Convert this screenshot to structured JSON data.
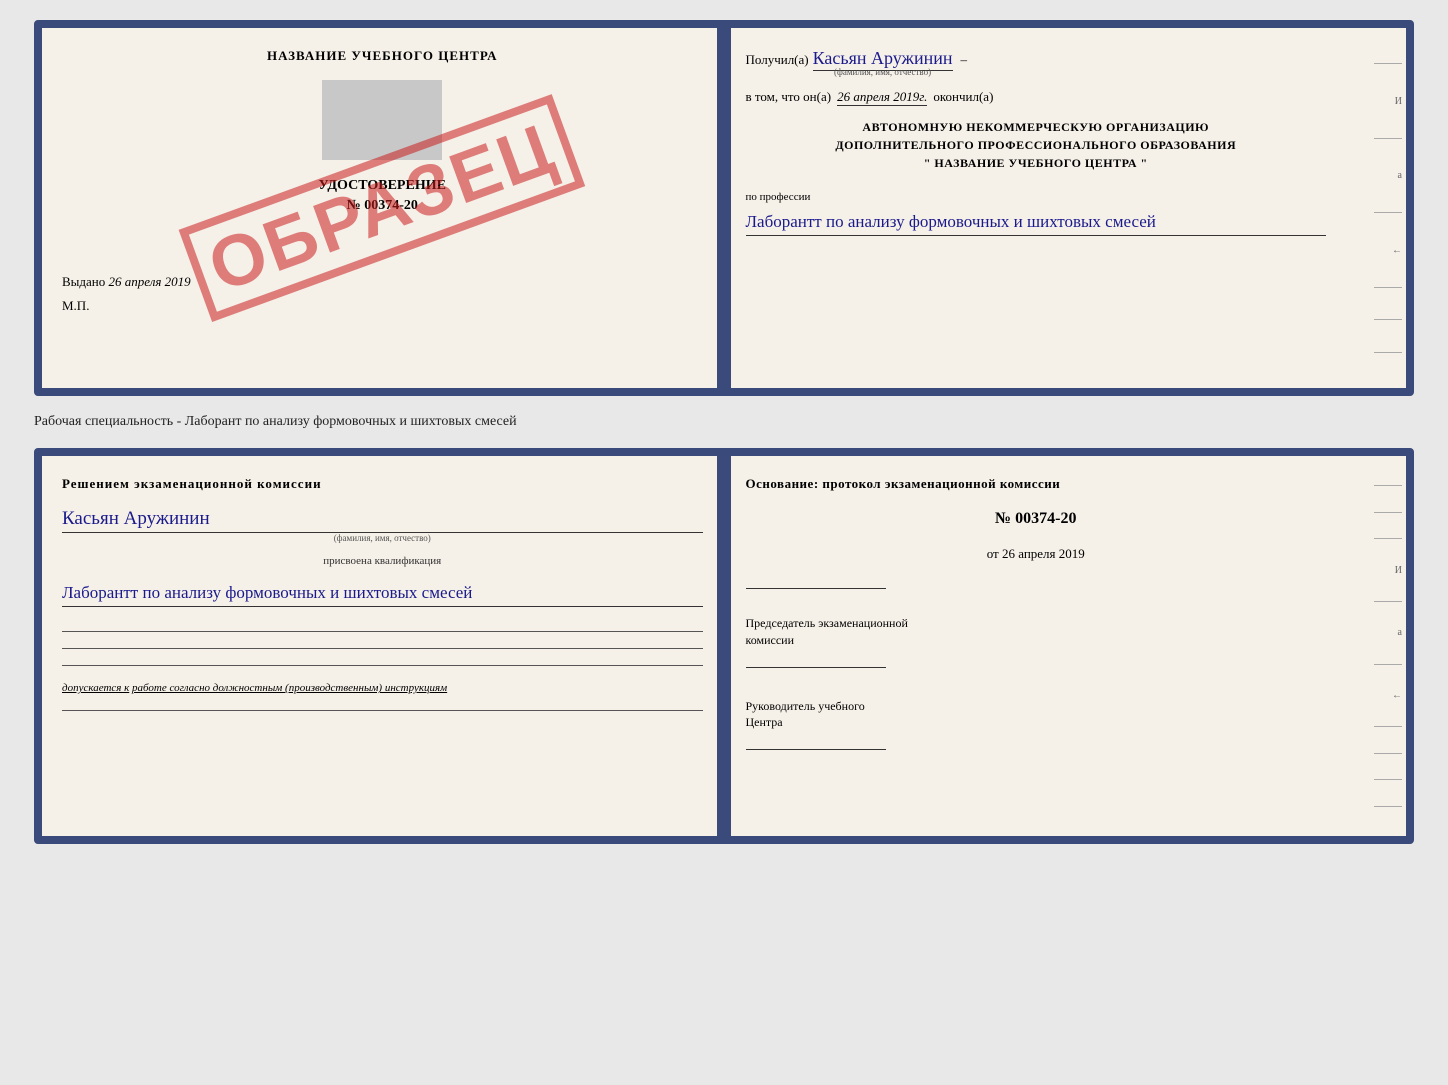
{
  "cert_top": {
    "left": {
      "title": "НАЗВАНИЕ УЧЕБНОГО ЦЕНТРА",
      "udost": "УДОСТОВЕРЕНИЕ",
      "number": "№ 00374-20",
      "vydano_label": "Выдано",
      "vydano_date": "26 апреля 2019",
      "mp": "М.П.",
      "stamp": "ОБРАЗЕЦ"
    },
    "right": {
      "poluchil": "Получил(а)",
      "recipient": "Касьян Аружинин",
      "recipient_small": "(фамилия, имя, отчество)",
      "vtom": "в том, что он(а)",
      "date": "26 апреля 2019г.",
      "okonchil": "окончил(а)",
      "org_line1": "АВТОНОМНУЮ НЕКОММЕРЧЕСКУЮ ОРГАНИЗАЦИЮ",
      "org_line2": "ДОПОЛНИТЕЛЬНОГО ПРОФЕССИОНАЛЬНОГО ОБРАЗОВАНИЯ",
      "org_line3": "\"  НАЗВАНИЕ УЧЕБНОГО ЦЕНТРА  \"",
      "prof_label": "по профессии",
      "profession": "Лаборантт по анализу формовочных и шихтовых смесей"
    },
    "spine_letters": [
      "И",
      "а",
      "←"
    ]
  },
  "specialty_label": "Рабочая специальность - Лаборант по анализу формовочных и шихтовых смесей",
  "cert_bottom": {
    "left": {
      "resheniem": "Решением экзаменационной комиссии",
      "name": "Касьян Аружинин",
      "name_small": "(фамилия, имя, отчество)",
      "prisvoena": "присвоена квалификация",
      "qualification": "Лаборантт по анализу формовочных и шихтовых смесей",
      "dopuskaetsya_prefix": "допускается к",
      "dopuskaetsya_text": "работе согласно должностным (производственным) инструкциям"
    },
    "right": {
      "osnovanie": "Основание: протокол экзаменационной комиссии",
      "number": "№ 00374-20",
      "ot_label": "от",
      "ot_date": "26 апреля 2019",
      "predsedatel_line1": "Председатель экзаменационной",
      "predsedatel_line2": "комиссии",
      "rukovoditel_line1": "Руководитель учебного",
      "rukovoditel_line2": "Центра"
    },
    "spine_letters": [
      "И",
      "а",
      "←"
    ]
  }
}
